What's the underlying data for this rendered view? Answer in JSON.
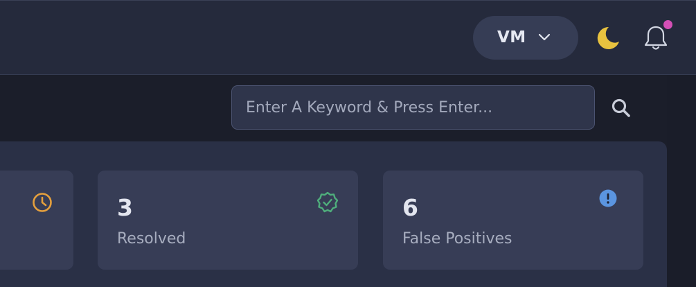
{
  "header": {
    "user_initials": "VM",
    "icons": {
      "user_menu": "chevron-down-icon",
      "theme": "moon-icon",
      "notifications": "bell-icon"
    },
    "notification_dot_color": "#d44fb6"
  },
  "search": {
    "placeholder": "Enter A Keyword & Press Enter...",
    "value": "",
    "icon": "search-icon"
  },
  "cards": [
    {
      "count": "",
      "label": "",
      "icon": "clock-icon",
      "icon_color": "#e5a03d"
    },
    {
      "count": "3",
      "label": "Resolved",
      "icon": "check-badge-icon",
      "icon_color": "#4fae7c"
    },
    {
      "count": "6",
      "label": "False Positives",
      "icon": "exclamation-circle-icon",
      "icon_color": "#5b95e0"
    }
  ]
}
